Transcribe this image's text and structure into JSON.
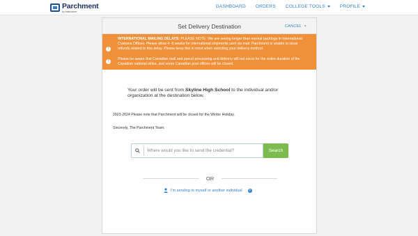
{
  "brand": {
    "name": "Parchment",
    "sub": "by Instructure",
    "colors": {
      "primary": "#1b2f5e",
      "link": "#2f7fd0",
      "alert": "#f0913a",
      "search_button": "#7cbc4f"
    }
  },
  "nav": {
    "items": [
      {
        "label": "DASHBOARD",
        "dropdown": false
      },
      {
        "label": "ORDERS",
        "dropdown": false
      },
      {
        "label": "COLLEGE TOOLS",
        "dropdown": true
      },
      {
        "label": "PROFILE",
        "dropdown": true
      }
    ]
  },
  "card": {
    "title": "Set Delivery Destination",
    "cancel_label": "CANCEL",
    "cancel_icon": "close-icon"
  },
  "alerts": [
    {
      "icon": "info-icon",
      "heading": "INTERNATIONAL MAILING DELAYS:",
      "body": " PLEASE NOTE: We are seeing longer than normal backlogs in International Customs Offices. Please allow 4 -6 weeks for international shipments sent via mail. Parchment is unable to issue refunds related to this delay. Please keep this in mind when selecting your delivery method."
    },
    {
      "icon": "info-icon",
      "heading": "",
      "body": "Please be aware that Canadian mail and parcel processing and delivery will not occur for the entire duration of the Canadian national strike, and some Canadian post offices will be closed."
    }
  ],
  "order": {
    "prefix": "Your order will be sent from ",
    "school": "Skyline High School",
    "suffix": " to the individual and/or organization at the destination below."
  },
  "notices": {
    "holiday": "2023-2024 Please note that Parchment will be closed for the Winter Holiday.",
    "sincerely": "Sincerely, The Parchment Team."
  },
  "search": {
    "placeholder": "Where would you like to send the credential?",
    "value": "",
    "button_label": "Search"
  },
  "divider": {
    "label": "OR"
  },
  "self_send": {
    "label": "I'm sending to myself or another individual",
    "help_glyph": "?"
  }
}
